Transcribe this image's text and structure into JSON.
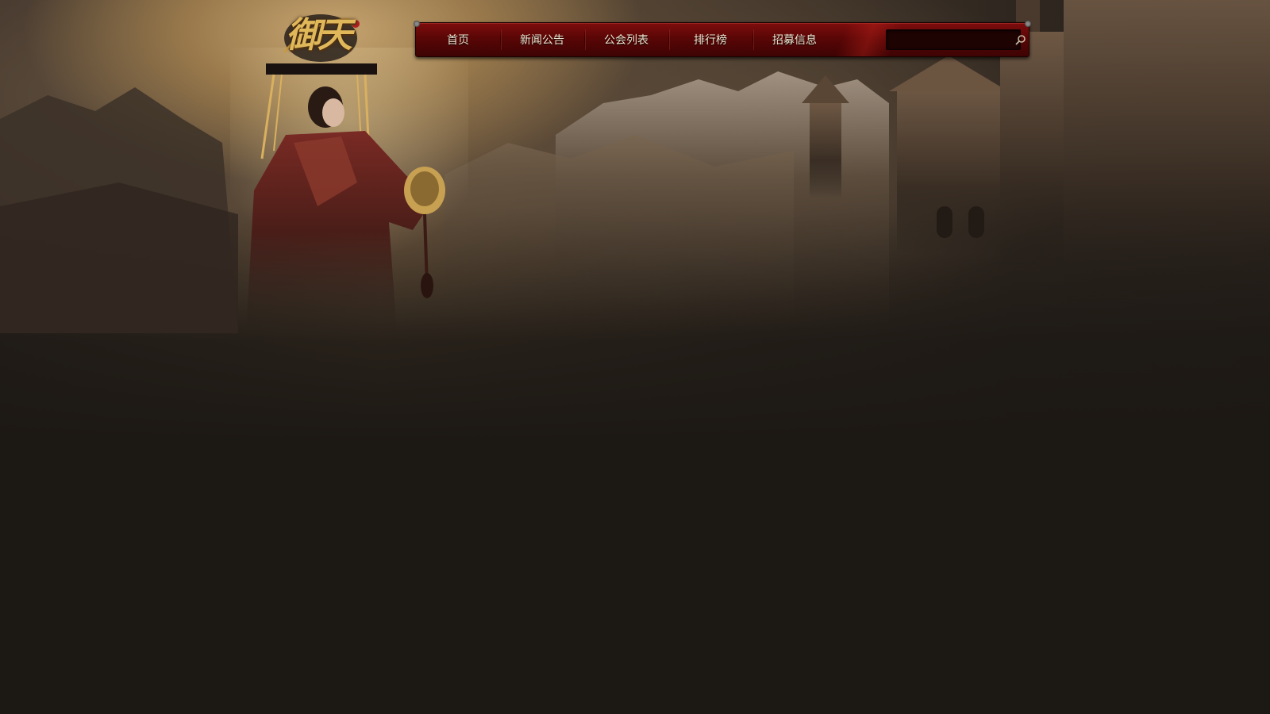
{
  "site": {
    "logo_text": "御天"
  },
  "nav": {
    "items": [
      {
        "label": "首页"
      },
      {
        "label": "新闻公告"
      },
      {
        "label": "公会列表"
      },
      {
        "label": "排行榜"
      },
      {
        "label": "招募信息"
      }
    ],
    "search": {
      "value": "",
      "placeholder": "",
      "icon": "search-icon"
    }
  },
  "colors": {
    "nav_bar": "#6a0909",
    "nav_text": "#f3e5cf",
    "page_background": "#1c1814",
    "logo_gold": "#e0b85a"
  }
}
